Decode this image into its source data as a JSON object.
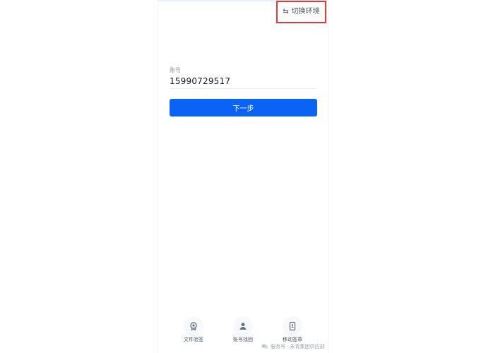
{
  "header": {
    "switch_environment_label": "切换环境",
    "switch_environment_icon": "swap-icon"
  },
  "form": {
    "account_label": "账号",
    "account_value": "15990729517",
    "next_button_label": "下一步"
  },
  "bottom_nav": [
    {
      "label": "文件验签",
      "icon": "badge-icon"
    },
    {
      "label": "账号找回",
      "icon": "user-icon"
    },
    {
      "label": "移动签章",
      "icon": "device-icon"
    }
  ],
  "watermark": {
    "text": "服务号 · 永青集团供应部",
    "icon": "wechat-icon"
  },
  "colors": {
    "primary": "#0b63f6",
    "highlight_border": "#e53935"
  }
}
